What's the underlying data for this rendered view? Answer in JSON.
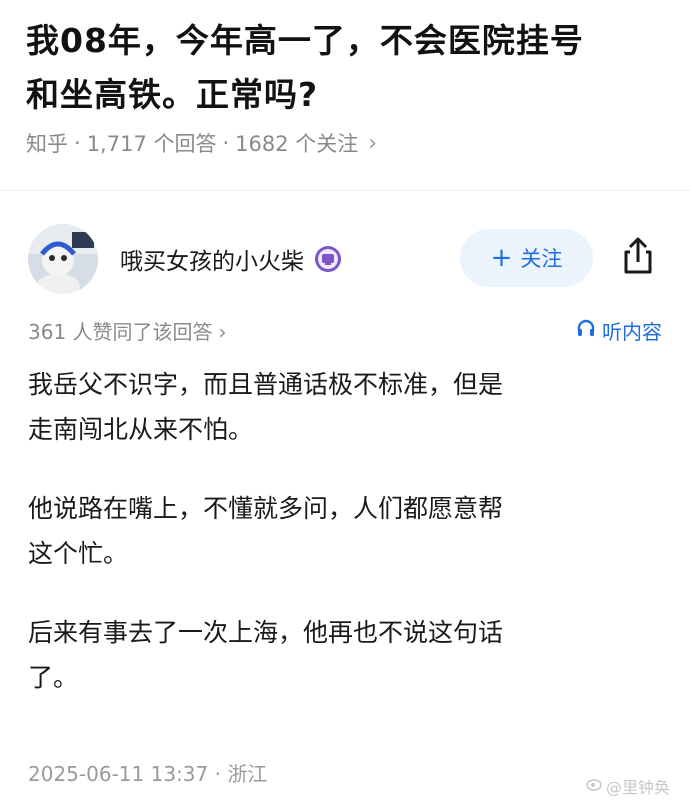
{
  "question": {
    "title_line1": "我08年，今年高一了，不会医院挂号",
    "title_line2": "和坐高铁。正常吗?",
    "source": "知乎",
    "answers": "1,717 个回答",
    "follows": "1682 个关注",
    "separator": "·"
  },
  "author": {
    "name": "哦买女孩的小火柴",
    "follow_label": "关注"
  },
  "answer": {
    "likes": "361 人赞同了该回答",
    "listen_label": "听内容",
    "paragraphs": [
      {
        "line1": "我岳父不识字，而且普通话极不标准，但是",
        "line2": "走南闯北从来不怕。"
      },
      {
        "line1": "他说路在嘴上，不懂就多问，人们都愿意帮",
        "line2": "这个忙。"
      },
      {
        "line1": "后来有事去了一次上海，他再也不说这句话",
        "line2": "了。"
      }
    ],
    "date": "2025-06-11 13:37",
    "location": "浙江"
  },
  "watermark": "@里钟奂",
  "colors": {
    "accent": "#1e6fe0",
    "follow_bg": "#ebf3fd",
    "badge": "#7a56c8"
  }
}
